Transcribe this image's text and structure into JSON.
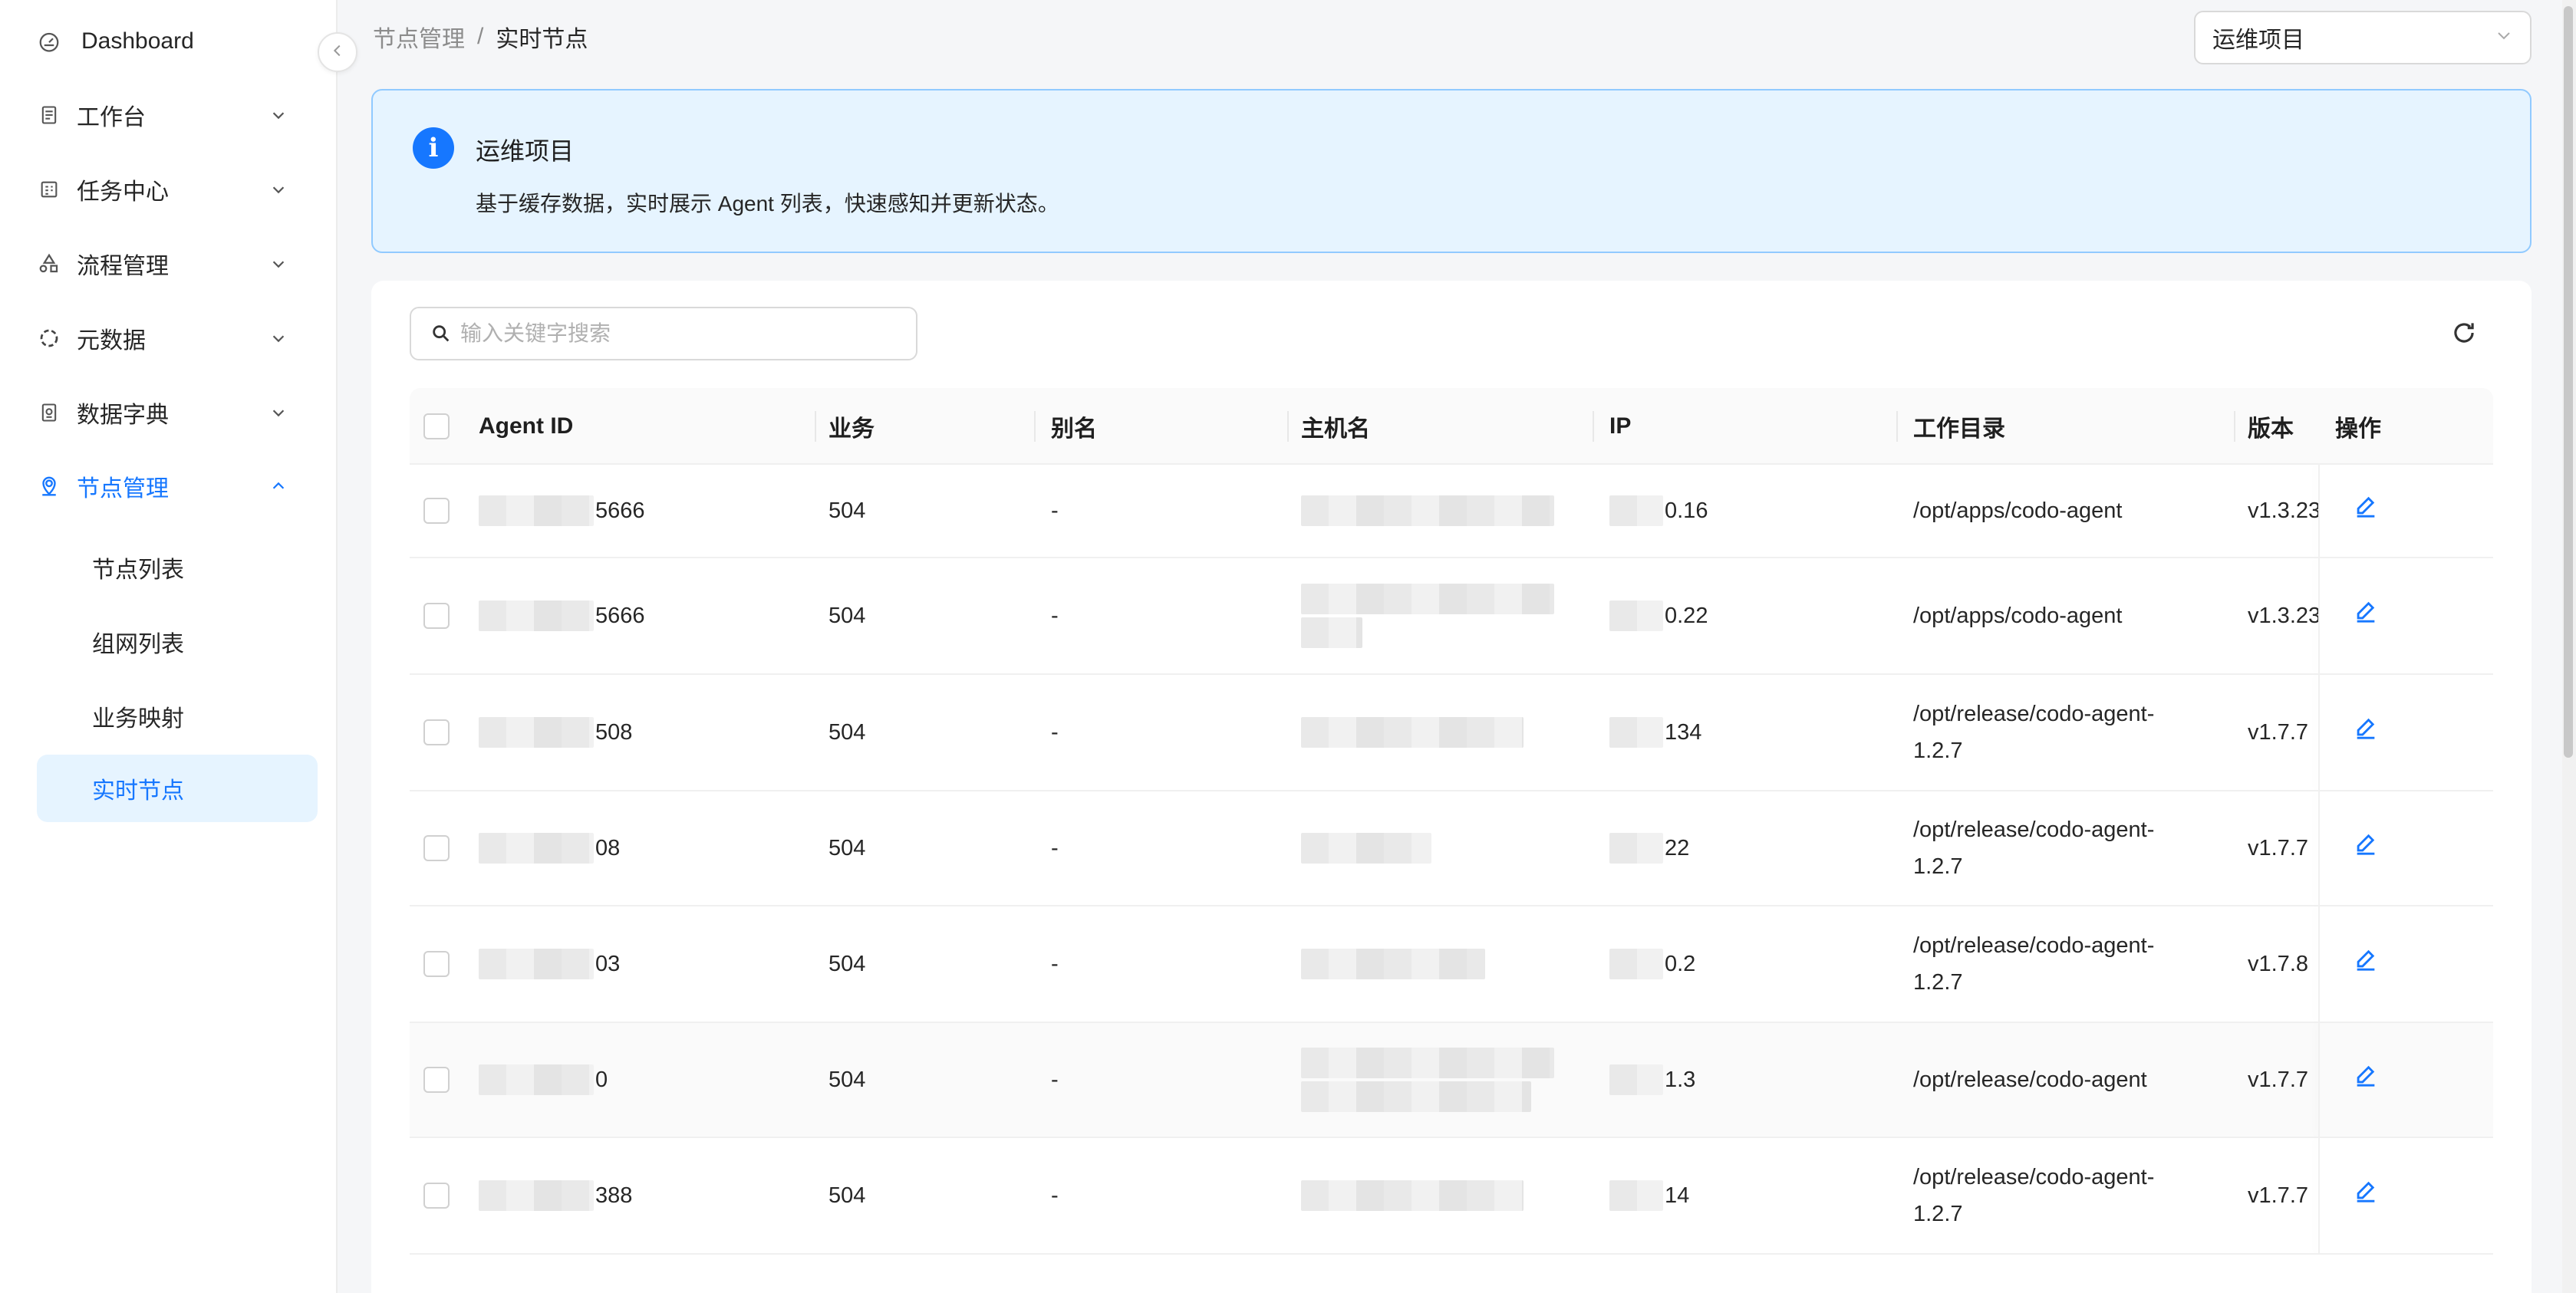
{
  "sidebar": {
    "items": [
      {
        "label": "Dashboard",
        "icon": "dashboard-icon"
      },
      {
        "label": "工作台",
        "icon": "file-icon"
      },
      {
        "label": "任务中心",
        "icon": "schedule-icon"
      },
      {
        "label": "流程管理",
        "icon": "flow-icon"
      },
      {
        "label": "元数据",
        "icon": "aim-icon"
      },
      {
        "label": "数据字典",
        "icon": "book-icon"
      },
      {
        "label": "节点管理",
        "icon": "location-icon"
      }
    ],
    "subitems": [
      "节点列表",
      "组网列表",
      "业务映射",
      "实时节点"
    ],
    "accent": "#1677ff"
  },
  "breadcrumb": {
    "parent": "节点管理",
    "separator": "/",
    "current": "实时节点"
  },
  "project_select": {
    "value": "运维项目"
  },
  "alert": {
    "title": "运维项目",
    "description": "基于缓存数据，实时展示 Agent 列表，快速感知并更新状态。"
  },
  "search": {
    "placeholder": "输入关键字搜索"
  },
  "table": {
    "columns": [
      "Agent ID",
      "业务",
      "别名",
      "主机名",
      "IP",
      "工作目录",
      "版本",
      "操作"
    ],
    "rows": [
      {
        "agent_id": "5666",
        "business": "504",
        "alias": "-",
        "ip": "0.16",
        "workdir": [
          "/opt/apps/codo-agent"
        ],
        "version": "v1.3.23"
      },
      {
        "agent_id": "5666",
        "business": "504",
        "alias": "-",
        "ip": "0.22",
        "workdir": [
          "/opt/apps/codo-agent"
        ],
        "version": "v1.3.23"
      },
      {
        "agent_id": "508",
        "business": "504",
        "alias": "-",
        "ip": "134",
        "workdir": [
          "/opt/release/codo-agent-",
          "1.2.7"
        ],
        "version": "v1.7.7"
      },
      {
        "agent_id": "08",
        "business": "504",
        "alias": "-",
        "ip": "22",
        "workdir": [
          "/opt/release/codo-agent-",
          "1.2.7"
        ],
        "version": "v1.7.7"
      },
      {
        "agent_id": "03",
        "business": "504",
        "alias": "-",
        "ip": "0.2",
        "workdir": [
          "/opt/release/codo-agent-",
          "1.2.7"
        ],
        "version": "v1.7.8"
      },
      {
        "agent_id": "0",
        "business": "504",
        "alias": "-",
        "ip": "1.3",
        "workdir": [
          "/opt/release/codo-agent"
        ],
        "version": "v1.7.7"
      },
      {
        "agent_id": "388",
        "business": "504",
        "alias": "-",
        "ip": "14",
        "workdir": [
          "/opt/release/codo-agent-",
          "1.2.7"
        ],
        "version": "v1.7.7"
      }
    ]
  }
}
